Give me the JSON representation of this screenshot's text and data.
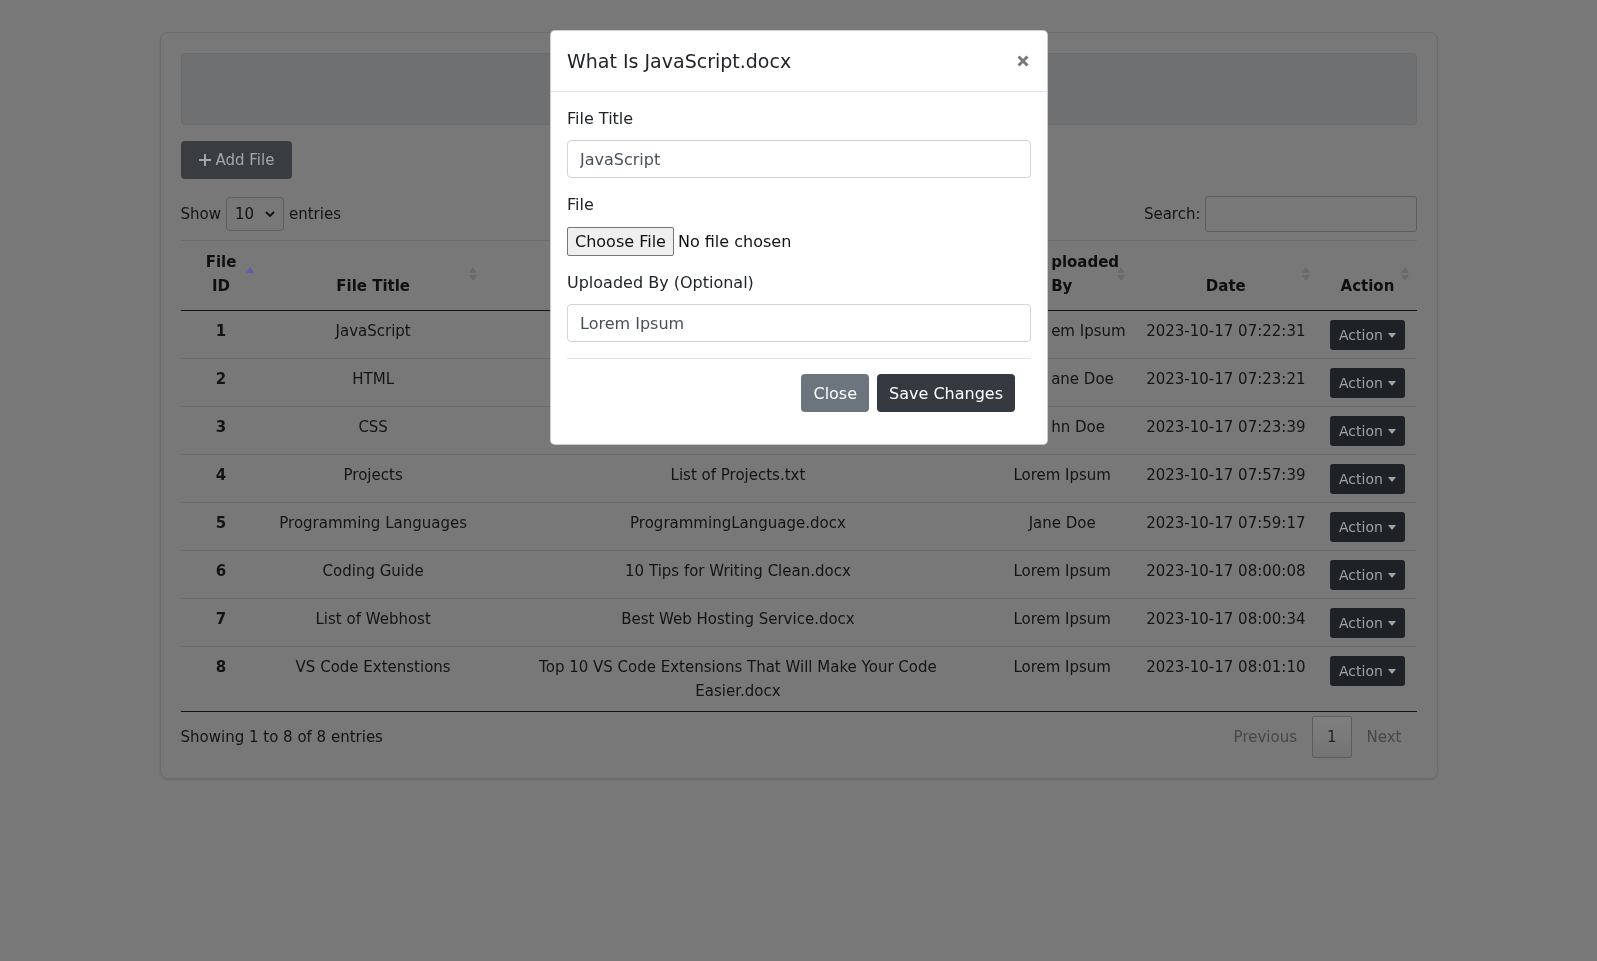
{
  "toolbar": {
    "add_button": "Add File"
  },
  "length_menu": {
    "label_before": "Show",
    "value": "10",
    "label_after": "entries"
  },
  "search": {
    "label": "Search:"
  },
  "table": {
    "columns": [
      {
        "label": "File ID",
        "sorted": true
      },
      {
        "label": "File Title",
        "sorted": false
      },
      {},
      {
        "label": "ploaded By",
        "sorted": false
      },
      {
        "label": "Date",
        "sorted": false
      },
      {
        "label": "Action",
        "sorted": false
      }
    ],
    "rows": [
      {
        "file_id": "1",
        "file_title": "JavaScript",
        "uploaded_by": "em Ipsum",
        "date": "2023-10-17 07:22:31",
        "action": "Action"
      },
      {
        "file_id": "2",
        "file_title": "HTML",
        "uploaded_by": "ane Doe",
        "date": "2023-10-17 07:23:21",
        "action": "Action"
      },
      {
        "file_id": "3",
        "file_title": "CSS",
        "uploaded_by": "hn Doe",
        "date": "2023-10-17 07:23:39",
        "action": "Action"
      },
      {
        "file_id": "4",
        "file_title": "Projects",
        "file": "List of Projects.txt",
        "uploaded_by": "Lorem Ipsum",
        "date": "2023-10-17 07:57:39",
        "action": "Action"
      },
      {
        "file_id": "5",
        "file_title": "Programming Languages",
        "file": "ProgrammingLanguage.docx",
        "uploaded_by": "Jane Doe",
        "date": "2023-10-17 07:59:17",
        "action": "Action"
      },
      {
        "file_id": "6",
        "file_title": "Coding Guide",
        "file": "10 Tips for Writing Clean.docx",
        "uploaded_by": "Lorem Ipsum",
        "date": "2023-10-17 08:00:08",
        "action": "Action"
      },
      {
        "file_id": "7",
        "file_title": "List of Webhost",
        "file": "Best Web Hosting Service.docx",
        "uploaded_by": "Lorem Ipsum",
        "date": "2023-10-17 08:00:34",
        "action": "Action"
      },
      {
        "file_id": "8",
        "file_title": "VS Code Extenstions",
        "file": "Top 10 VS Code Extensions That Will Make Your Code Easier.docx",
        "uploaded_by": "Lorem Ipsum",
        "date": "2023-10-17 08:01:10",
        "action": "Action"
      }
    ]
  },
  "info": "Showing 1 to 8 of 8 entries",
  "pagination": {
    "previous": {
      "label": "Previous",
      "disabled": true
    },
    "pages": [
      {
        "label": "1",
        "selected": true
      }
    ],
    "next": {
      "label": "Next",
      "disabled": true
    }
  },
  "modal": {
    "title": "What Is JavaScript.docx",
    "fields": [
      {
        "kind": "text",
        "label": "File Title",
        "value": "JavaScript"
      },
      {
        "kind": "file",
        "label": "File",
        "button": "Choose File",
        "status": "No file chosen"
      },
      {
        "kind": "text",
        "label": "Uploaded By (Optional)",
        "value": "Lorem Ipsum"
      }
    ],
    "buttons": [
      {
        "kind": "secondary",
        "label": "Close"
      },
      {
        "kind": "primary",
        "label": "Save Changes"
      }
    ]
  }
}
